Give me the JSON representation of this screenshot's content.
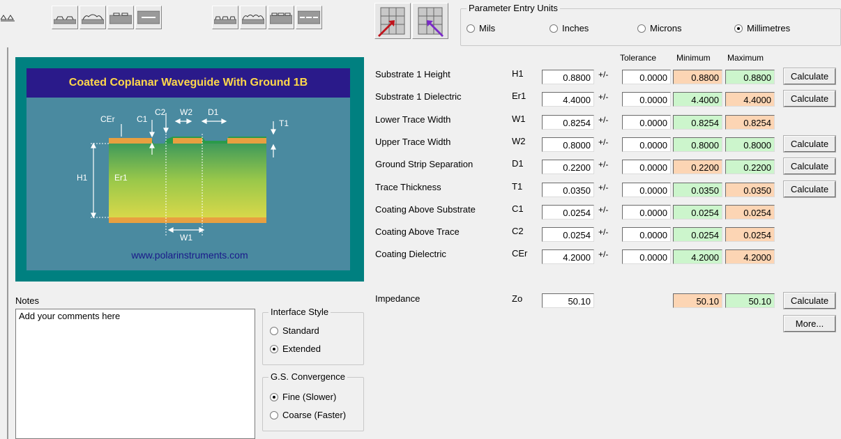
{
  "units": {
    "title": "Parameter Entry Units",
    "options": [
      {
        "label": "Mils",
        "selected": false
      },
      {
        "label": "Inches",
        "selected": false
      },
      {
        "label": "Microns",
        "selected": false
      },
      {
        "label": "Millimetres",
        "selected": true
      }
    ]
  },
  "diagram": {
    "title": "Coated Coplanar Waveguide With Ground 1B",
    "url": "www.polarinstruments.com",
    "labels": [
      "CEr",
      "C1",
      "C2",
      "W2",
      "D1",
      "T1",
      "H1",
      "Er1",
      "W1"
    ]
  },
  "columns": {
    "tolerance": "Tolerance",
    "minimum": "Minimum",
    "maximum": "Maximum"
  },
  "plus_minus": "+/-",
  "parameters": [
    {
      "label": "Substrate 1 Height",
      "symbol": "H1",
      "value": "0.8800",
      "tolerance": "0.0000",
      "min": "0.8800",
      "max": "0.8800",
      "min_color": "orange",
      "max_color": "green",
      "calc": "Calculate"
    },
    {
      "label": "Substrate 1 Dielectric",
      "symbol": "Er1",
      "value": "4.4000",
      "tolerance": "0.0000",
      "min": "4.4000",
      "max": "4.4000",
      "min_color": "green",
      "max_color": "orange",
      "calc": "Calculate"
    },
    {
      "label": "Lower Trace Width",
      "symbol": "W1",
      "value": "0.8254",
      "tolerance": "0.0000",
      "min": "0.8254",
      "max": "0.8254",
      "min_color": "green",
      "max_color": "orange",
      "calc": ""
    },
    {
      "label": "Upper Trace Width",
      "symbol": "W2",
      "value": "0.8000",
      "tolerance": "0.0000",
      "min": "0.8000",
      "max": "0.8000",
      "min_color": "green",
      "max_color": "green",
      "calc": "Calculate"
    },
    {
      "label": "Ground Strip Separation",
      "symbol": "D1",
      "value": "0.2200",
      "tolerance": "0.0000",
      "min": "0.2200",
      "max": "0.2200",
      "min_color": "orange",
      "max_color": "green",
      "calc": "Calculate"
    },
    {
      "label": "Trace Thickness",
      "symbol": "T1",
      "value": "0.0350",
      "tolerance": "0.0000",
      "min": "0.0350",
      "max": "0.0350",
      "min_color": "green",
      "max_color": "orange",
      "calc": "Calculate"
    },
    {
      "label": "Coating Above Substrate",
      "symbol": "C1",
      "value": "0.0254",
      "tolerance": "0.0000",
      "min": "0.0254",
      "max": "0.0254",
      "min_color": "green",
      "max_color": "orange",
      "calc": ""
    },
    {
      "label": "Coating Above Trace",
      "symbol": "C2",
      "value": "0.0254",
      "tolerance": "0.0000",
      "min": "0.0254",
      "max": "0.0254",
      "min_color": "green",
      "max_color": "orange",
      "calc": ""
    },
    {
      "label": "Coating Dielectric",
      "symbol": "CEr",
      "value": "4.2000",
      "tolerance": "0.0000",
      "min": "4.2000",
      "max": "4.2000",
      "min_color": "green",
      "max_color": "orange",
      "calc": ""
    }
  ],
  "impedance": {
    "label": "Impedance",
    "symbol": "Zo",
    "value": "50.10",
    "min": "50.10",
    "max": "50.10",
    "calc": "Calculate",
    "more": "More..."
  },
  "notes": {
    "label": "Notes",
    "text": "Add your comments here"
  },
  "interface_style": {
    "title": "Interface Style",
    "options": [
      {
        "label": "Standard",
        "selected": false
      },
      {
        "label": "Extended",
        "selected": true
      }
    ]
  },
  "convergence": {
    "title": "G.S. Convergence",
    "options": [
      {
        "label": "Fine (Slower)",
        "selected": true
      },
      {
        "label": "Coarse (Faster)",
        "selected": false
      }
    ]
  },
  "colors": {
    "teal": "#008080",
    "orange_cell": "#fcd5b4",
    "green_cell": "#ccf5cc",
    "title_bar": "#2a1a8a",
    "title_text": "#ffd84a"
  }
}
